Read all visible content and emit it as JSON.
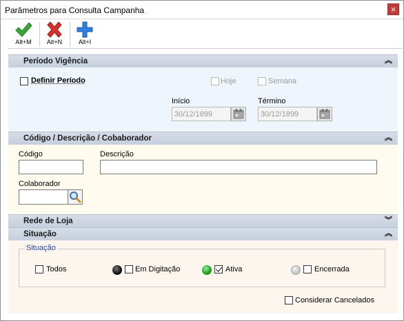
{
  "window": {
    "title": "Parâmetros para Consulta Campanha",
    "close_glyph": "×"
  },
  "toolbar": {
    "confirm_label": "Alt+M",
    "cancel_label": "Alt+N",
    "new_label": "Alt+I"
  },
  "periodo": {
    "header": "Período Vigência",
    "definir_label": "Definir Período",
    "hoje_label": "Hoje",
    "semana_label": "Semana",
    "inicio_label": "Início",
    "inicio_value": "30/12/1899",
    "termino_label": "Término",
    "termino_value": "30/12/1899"
  },
  "codigo": {
    "header": "Código / Descrição / Cobaborador",
    "codigo_label": "Código",
    "descricao_label": "Descrição",
    "colaborador_label": "Colaborador",
    "codigo_value": "",
    "descricao_value": "",
    "colaborador_value": ""
  },
  "rede": {
    "header": "Rede de Loja"
  },
  "situacao": {
    "header": "Situação",
    "group_title": "Situação",
    "todos_label": "Todos",
    "em_digitacao_label": "Em Digitação",
    "ativa_label": "Ativa",
    "encerrada_label": "Encerrada",
    "considerar_label": "Considerar Cancelados"
  },
  "colors": {
    "section_header": "#cdd5e1",
    "periodo_bg": "#eef5fc",
    "codigo_bg": "#fffbee",
    "situacao_bg": "#fcf6ef",
    "group_title": "#1f3ea5"
  },
  "icons": [
    "check-icon",
    "x-icon",
    "plus-icon",
    "calendar-icon",
    "magnifier-icon",
    "chevron-up-icon",
    "chevron-down-icon"
  ]
}
